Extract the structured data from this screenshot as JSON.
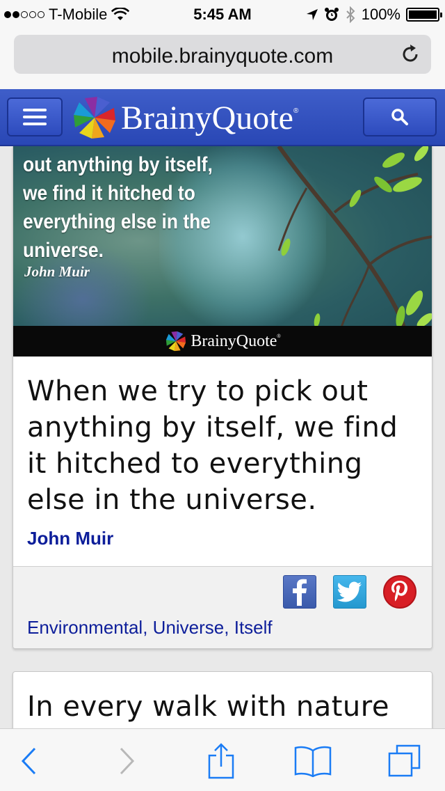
{
  "status_bar": {
    "carrier": "T-Mobile",
    "time": "5:45 AM",
    "battery": "100%",
    "signal_bars_filled": 2,
    "signal_bars_total": 5
  },
  "browser": {
    "url": "mobile.brainyquote.com"
  },
  "site_header": {
    "brand": "BrainyQuote",
    "registered_mark": "®"
  },
  "quote_card_1": {
    "image_overlay_lines": [
      "out anything by itself,",
      "we find it hitched to",
      "everything else in the",
      "universe."
    ],
    "image_author": "John Muir",
    "image_brand": "BrainyQuote",
    "image_registered_mark": "®",
    "text": "When we try to pick out anything by itself, we find it hitched to everything else in the universe.",
    "author": "John Muir",
    "tags": [
      "Environmental",
      "Universe",
      "Itself"
    ],
    "tag_separator": ",",
    "social": [
      "facebook-icon",
      "twitter-icon",
      "pinterest-icon"
    ]
  },
  "quote_card_2": {
    "text": "In every walk with nature"
  },
  "colors": {
    "header_blue": "#2f4fc0",
    "link_blue": "#0d1e9a",
    "ios_blue": "#1a7cf5"
  }
}
